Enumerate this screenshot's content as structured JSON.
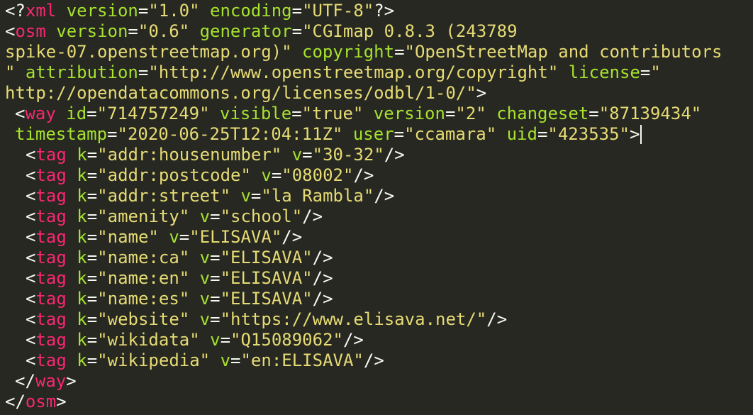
{
  "xml_decl": {
    "open": "<?",
    "name": "xml",
    "attrs": [
      {
        "name": "version",
        "value": "\"1.0\""
      },
      {
        "name": "encoding",
        "value": "\"UTF-8\""
      }
    ],
    "close": "?>"
  },
  "osm_open": {
    "name": "osm",
    "version_attr": "version",
    "version_val": "\"0.6\"",
    "generator_attr": "generator",
    "generator_val_1": "\"CGImap 0.8.3 (243789",
    "generator_val_2": "spike-07.openstreetmap.org)\"",
    "copyright_attr": "copyright",
    "copyright_val_1": "\"OpenStreetMap and contributors",
    "copyright_val_2": "\"",
    "attribution_attr": "attribution",
    "attribution_val": "\"http://www.openstreetmap.org/copyright\"",
    "license_attr": "license",
    "license_val_1": "\"",
    "license_val_2": "http://opendatacommons.org/licenses/odbl/1-0/\""
  },
  "way_open": {
    "name": "way",
    "id_attr": "id",
    "id_val": "\"714757249\"",
    "visible_attr": "visible",
    "visible_val": "\"true\"",
    "version_attr": "version",
    "version_val": "\"2\"",
    "changeset_attr": "changeset",
    "changeset_val": "\"87139434\"",
    "timestamp_attr": "timestamp",
    "timestamp_val": "\"2020-06-25T12:04:11Z\"",
    "user_attr": "user",
    "user_val": "\"ccamara\"",
    "uid_attr": "uid",
    "uid_val": "\"423535\""
  },
  "tag_element": "tag",
  "tag_k": "k",
  "tag_v": "v",
  "tags": [
    {
      "k": "\"addr:housenumber\"",
      "v": "\"30-32\""
    },
    {
      "k": "\"addr:postcode\"",
      "v": "\"08002\""
    },
    {
      "k": "\"addr:street\"",
      "v": "\"la Rambla\""
    },
    {
      "k": "\"amenity\"",
      "v": "\"school\""
    },
    {
      "k": "\"name\"",
      "v": "\"ELISAVA\""
    },
    {
      "k": "\"name:ca\"",
      "v": "\"ELISAVA\""
    },
    {
      "k": "\"name:en\"",
      "v": "\"ELISAVA\""
    },
    {
      "k": "\"name:es\"",
      "v": "\"ELISAVA\""
    },
    {
      "k": "\"website\"",
      "v": "\"https://www.elisava.net/\""
    },
    {
      "k": "\"wikidata\"",
      "v": "\"Q15089062\""
    },
    {
      "k": "\"wikipedia\"",
      "v": "\"en:ELISAVA\""
    }
  ],
  "way_close": "way",
  "osm_close": "osm",
  "colors": {
    "background": "#272822",
    "tag_name": "#f92672",
    "attribute": "#a6e22e",
    "string": "#e6db74",
    "punctuation": "#f8f8f2"
  }
}
